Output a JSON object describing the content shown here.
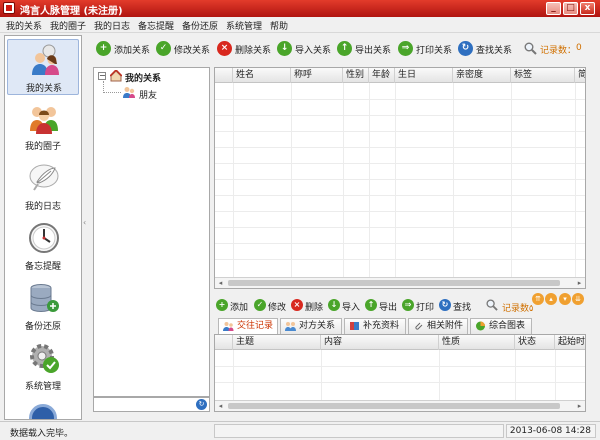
{
  "window": {
    "title": "鸿言人脉管理 (未注册)",
    "minimize": "_",
    "maximize": "□",
    "close": "x"
  },
  "menu": [
    "我的关系",
    "我的圈子",
    "我的日志",
    "备忘提醒",
    "备份还原",
    "系统管理",
    "帮助"
  ],
  "sidebar": [
    {
      "label": "我的关系",
      "icon": "people-icon"
    },
    {
      "label": "我的圈子",
      "icon": "group-icon"
    },
    {
      "label": "我的日志",
      "icon": "quill-icon"
    },
    {
      "label": "备忘提醒",
      "icon": "clock-icon"
    },
    {
      "label": "备份还原",
      "icon": "database-icon"
    },
    {
      "label": "系统管理",
      "icon": "gear-check-icon"
    }
  ],
  "toolbar": {
    "buttons": [
      {
        "label": "添加关系",
        "icon": "add-icon",
        "glyph": "+",
        "color": "#4aa52a"
      },
      {
        "label": "修改关系",
        "icon": "check-icon",
        "glyph": "✓",
        "color": "#4aa52a"
      },
      {
        "label": "删除关系",
        "icon": "delete-icon",
        "glyph": "×",
        "color": "#d8281e"
      },
      {
        "label": "导入关系",
        "icon": "import-icon",
        "glyph": "↓",
        "color": "#4aa52a"
      },
      {
        "label": "导出关系",
        "icon": "export-icon",
        "glyph": "↑",
        "color": "#4aa52a"
      },
      {
        "label": "打印关系",
        "icon": "print-icon",
        "glyph": "⇒",
        "color": "#4aa52a"
      },
      {
        "label": "查找关系",
        "icon": "find-icon",
        "glyph": "↻",
        "color": "#2e6fc0"
      }
    ],
    "record_label": "记录数：",
    "record_count": "0"
  },
  "tree": {
    "root": "我的关系",
    "child": "朋友",
    "collapse": "−"
  },
  "table": {
    "columns": [
      "姓名",
      "称呼",
      "性别",
      "年龄",
      "生日",
      "亲密度",
      "标签",
      "简"
    ]
  },
  "bottom_toolbar": {
    "buttons": [
      {
        "label": "添加",
        "icon": "add-icon",
        "glyph": "+",
        "color": "#4aa52a"
      },
      {
        "label": "修改",
        "icon": "check-icon",
        "glyph": "✓",
        "color": "#4aa52a"
      },
      {
        "label": "删除",
        "icon": "delete-icon",
        "glyph": "×",
        "color": "#d8281e"
      },
      {
        "label": "导入",
        "icon": "import-icon",
        "glyph": "↓",
        "color": "#4aa52a"
      },
      {
        "label": "导出",
        "icon": "export-icon",
        "glyph": "↑",
        "color": "#4aa52a"
      },
      {
        "label": "打印",
        "icon": "print-icon",
        "glyph": "⇒",
        "color": "#4aa52a"
      },
      {
        "label": "查找",
        "icon": "find-icon",
        "glyph": "↻",
        "color": "#2e6fc0"
      }
    ],
    "record_label": "记录数：",
    "record_count": "0"
  },
  "tabs": [
    "交往记录",
    "对方关系",
    "补充资料",
    "相关附件",
    "综合图表"
  ],
  "subtable": {
    "columns": [
      "主题",
      "内容",
      "性质",
      "状态",
      "起始时"
    ]
  },
  "status": {
    "message": "数据载入完毕。",
    "datetime": "2013-06-08  14:28"
  },
  "colors": {
    "title": "#c8241c",
    "accent": "#cc3300",
    "record": "#d07000"
  }
}
